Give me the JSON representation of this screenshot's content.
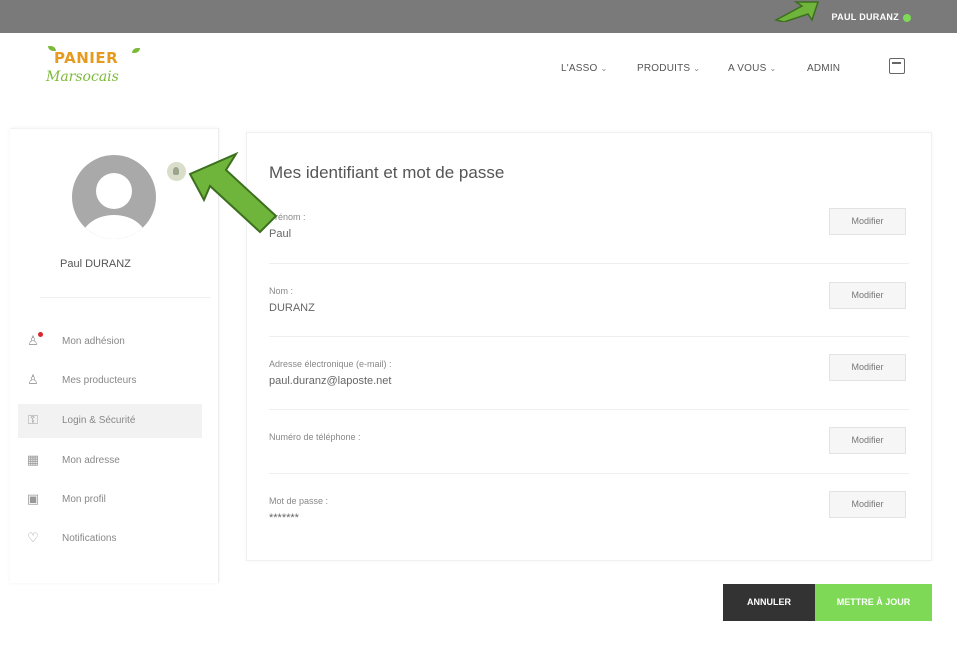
{
  "topbar": {
    "user_name": "PAUL DURANZ"
  },
  "logo": {
    "line1": "PANIER",
    "line2": "Marsocais"
  },
  "nav": {
    "items": [
      {
        "label": "L'ASSO",
        "has_dropdown": true
      },
      {
        "label": "PRODUITS",
        "has_dropdown": true
      },
      {
        "label": "A VOUS",
        "has_dropdown": true
      },
      {
        "label": "ADMIN",
        "has_dropdown": false
      }
    ],
    "cart_icon": "cart-icon"
  },
  "profile": {
    "name": "Paul DURANZ"
  },
  "sidebar": {
    "items": [
      {
        "label": "Mon adhésion",
        "icon": "user-icon",
        "badge": true,
        "active": false
      },
      {
        "label": "Mes producteurs",
        "icon": "users-icon",
        "badge": false,
        "active": false
      },
      {
        "label": "Login & Sécurité",
        "icon": "lock-user-icon",
        "badge": false,
        "active": true
      },
      {
        "label": "Mon adresse",
        "icon": "building-icon",
        "badge": false,
        "active": false
      },
      {
        "label": "Mon profil",
        "icon": "id-card-icon",
        "badge": false,
        "active": false
      },
      {
        "label": "Notifications",
        "icon": "tag-icon",
        "badge": false,
        "active": false
      }
    ]
  },
  "main": {
    "title": "Mes identifiant et mot de passe",
    "fields": [
      {
        "label": "Prénom :",
        "value": "Paul"
      },
      {
        "label": "Nom :",
        "value": "DURANZ"
      },
      {
        "label": "Adresse électronique (e-mail) :",
        "value": "paul.duranz@laposte.net"
      },
      {
        "label": "Numéro de téléphone :",
        "value": ""
      },
      {
        "label": "Mot de passe :",
        "value": "*******"
      }
    ],
    "modify_label": "Modifier"
  },
  "actions": {
    "cancel_label": "ANNULER",
    "save_label": "METTRE À JOUR"
  },
  "colors": {
    "accent_green": "#7ed957",
    "topbar_gray": "#7a7a7a",
    "badge_red": "#d9262f",
    "dark_button": "#333333"
  }
}
